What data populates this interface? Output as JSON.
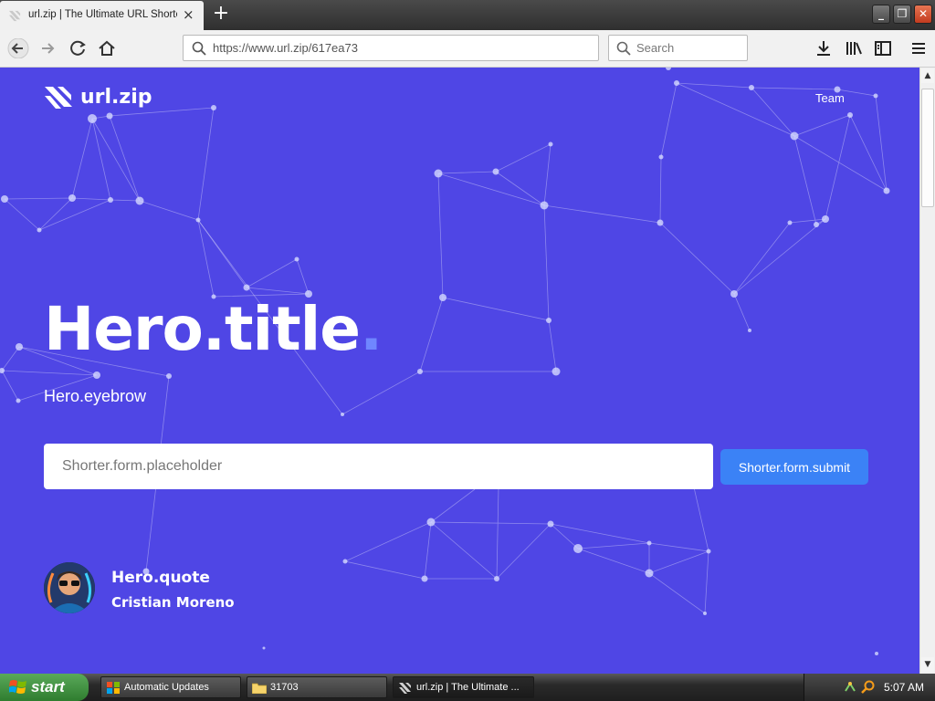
{
  "browser": {
    "tab_title": "url.zip | The Ultimate URL Shortener",
    "tab_close": "×",
    "new_tab": "+",
    "url": "https://www.url.zip/617ea73",
    "search_placeholder": "Search"
  },
  "site": {
    "logo_text": "url.zip",
    "nav": {
      "team": "Team"
    },
    "hero": {
      "title": "Hero.title",
      "title_dot": ".",
      "eyebrow": "Hero.eyebrow",
      "quote": "Hero.quote",
      "quote_author": "Cristian Moreno"
    },
    "shorter_form": {
      "placeholder": "Shorter.form.placeholder",
      "submit": "Shorter.form.submit"
    }
  },
  "taskbar": {
    "start": "start",
    "items": [
      {
        "label": "Automatic Updates"
      },
      {
        "label": "31703"
      },
      {
        "label": "url.zip | The Ultimate ..."
      }
    ],
    "clock": "5:07 AM"
  },
  "colors": {
    "page_bg": "#4f46e5",
    "button": "#3b82f6",
    "accent_dot": "#6f86ff"
  }
}
